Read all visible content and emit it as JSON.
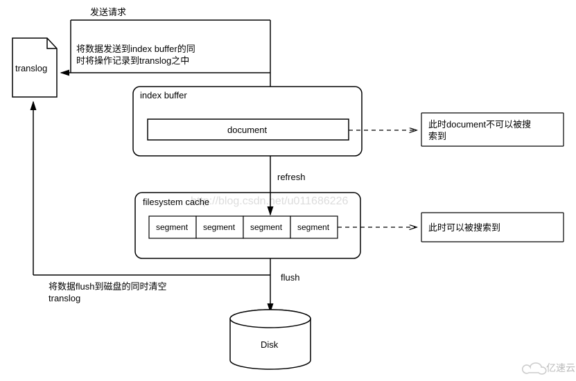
{
  "labels": {
    "send_request": "发送请求",
    "translog_note": "将数据发送到index buffer的同\n时将操作记录到translog之中",
    "translog": "translog",
    "index_buffer": "index buffer",
    "document": "document",
    "doc_not_searchable": "此时document不可以被搜\n索到",
    "refresh": "refresh",
    "filesystem_cache": "filesystem cache",
    "segment": "segment",
    "searchable_now": "此时可以被搜索到",
    "flush": "flush",
    "flush_note": "将数据flush到磁盘的同时清空\ntranslog",
    "disk": "Disk"
  },
  "watermark": {
    "text": "http://blog.csdn.net/u011686226",
    "brand": "亿速云"
  }
}
